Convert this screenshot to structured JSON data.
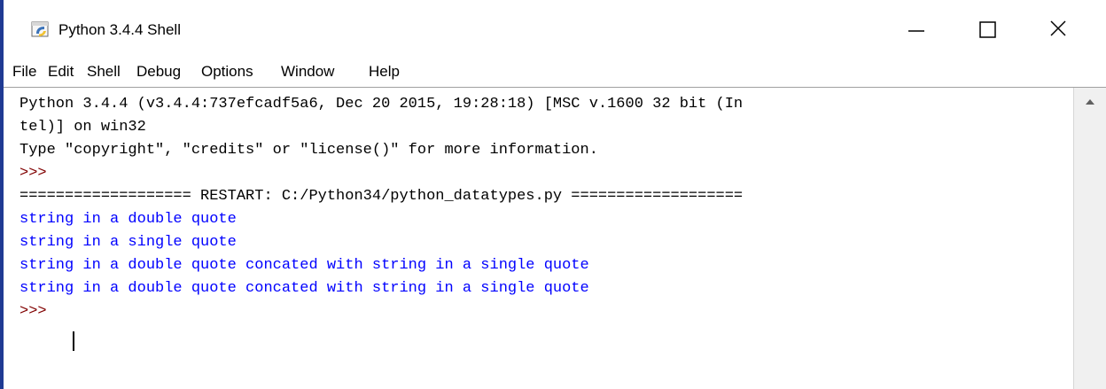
{
  "window": {
    "title": "Python 3.4.4 Shell",
    "icon": "idle-python-icon",
    "controls": {
      "minimize_icon": "minimize-icon",
      "maximize_icon": "maximize-icon",
      "close_icon": "close-icon"
    }
  },
  "menu": {
    "items": [
      "File",
      "Edit",
      "Shell",
      "Debug",
      "Options",
      "Window",
      "Help"
    ]
  },
  "shell": {
    "lines": [
      "Python 3.4.4 (v3.4.4:737efcadf5a6, Dec 20 2015, 19:28:18) [MSC v.1600 32 bit (In",
      "tel)] on win32",
      "Type \"copyright\", \"credits\" or \"license()\" for more information.",
      ">>>",
      "=================== RESTART: C:/Python34/python_datatypes.py ===================",
      "string in a double quote",
      "string in a single quote",
      "string in a double quote concated with string in a single quote",
      "string in a double quote concated with string in a single quote",
      ">>> "
    ]
  },
  "colors": {
    "text": "#000000",
    "prompt": "#800000",
    "output": "#0000ff",
    "edge": "#1f3a93"
  }
}
